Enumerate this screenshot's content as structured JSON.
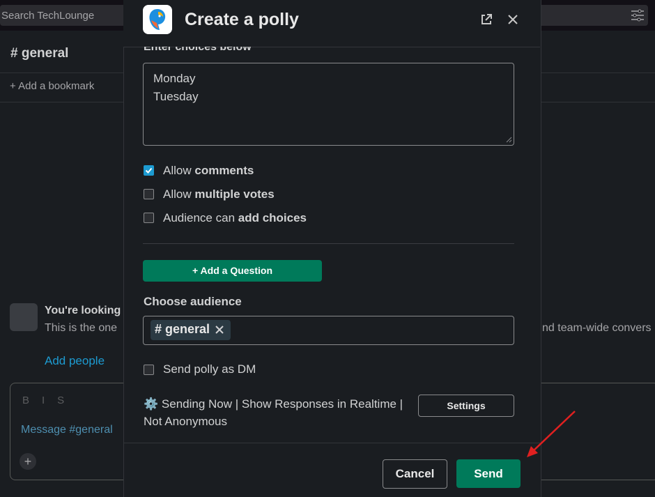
{
  "background": {
    "search_placeholder": "Search TechLounge",
    "channel_title": "# general",
    "bookmark": "+  Add a bookmark",
    "intro_title": "You're looking",
    "intro_sub": "This is the one",
    "intro_sub_right": "nd team-wide convers",
    "add_people": "Add people",
    "composer_format": "BIS",
    "composer_placeholder": "Message #general"
  },
  "modal": {
    "title": "Create a polly",
    "choices_label": "Enter choices below",
    "choices": [
      "Monday",
      "Tuesday"
    ],
    "options": [
      {
        "prefix": "Allow ",
        "bold": "comments",
        "suffix": "",
        "checked": true
      },
      {
        "prefix": "Allow ",
        "bold": "multiple votes",
        "suffix": "",
        "checked": false
      },
      {
        "prefix": "Audience can ",
        "bold": "add choices",
        "suffix": "",
        "checked": false
      }
    ],
    "add_question": "+ Add a Question",
    "audience_label": "Choose audience",
    "audience_chip": "# general",
    "dm_label": "Send polly as DM",
    "info_icon": "⚙️",
    "info_text": "Sending Now | Show Responses in Realtime | Not Anonymous",
    "settings_label": "Settings",
    "cancel_label": "Cancel",
    "send_label": "Send"
  },
  "colors": {
    "accent": "#007a5a",
    "arrow": "#e02020"
  }
}
